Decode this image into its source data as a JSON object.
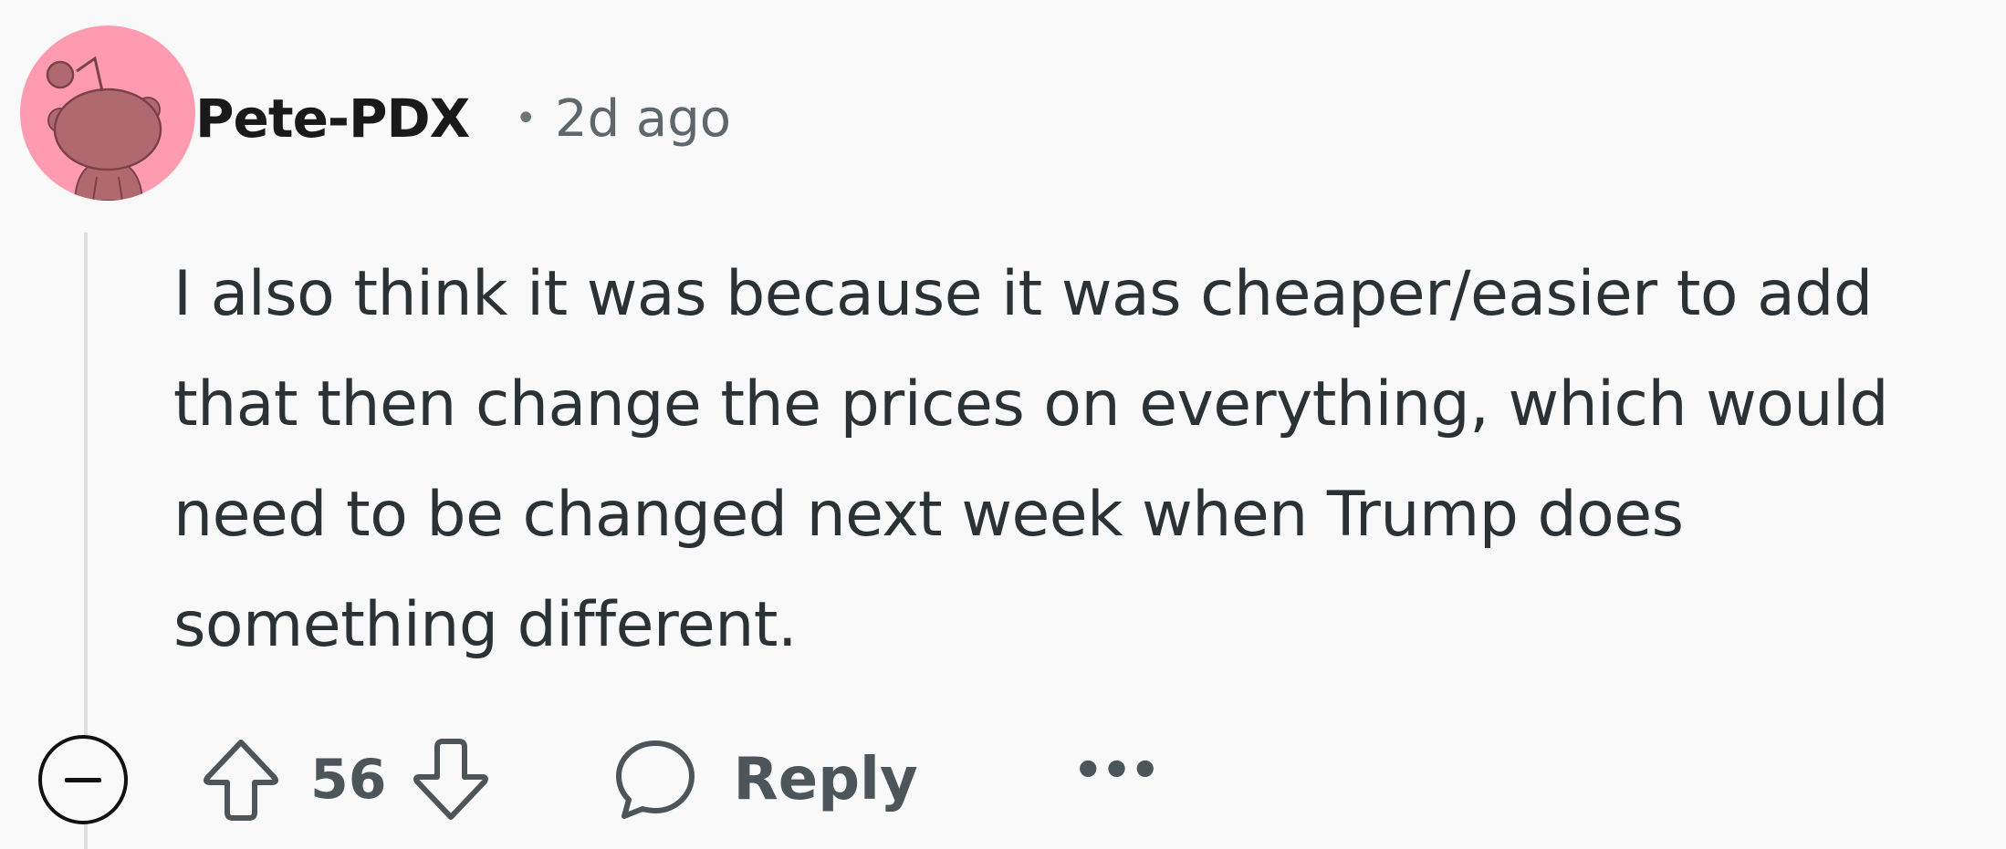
{
  "comment": {
    "author": "Pete-PDX",
    "separator": "•",
    "timestamp": "2d ago",
    "body": "I also think it was because it was cheaper/easier to add that then change the prices on everything, which would need to be changed next week when Trump does something different.",
    "score": "56",
    "reply_label": "Reply",
    "more_label": "•••"
  },
  "icons": {
    "avatar": "snoo-avatar",
    "collapse": "collapse-minus-icon",
    "upvote": "upvote-arrow-icon",
    "downvote": "downvote-arrow-icon",
    "reply": "speech-bubble-icon"
  },
  "colors": {
    "background": "#f9f9f9",
    "avatar_bg": "#ff9bb0",
    "snoo": "#b0696f",
    "text": "#2a3236",
    "muted": "#5d676c"
  }
}
